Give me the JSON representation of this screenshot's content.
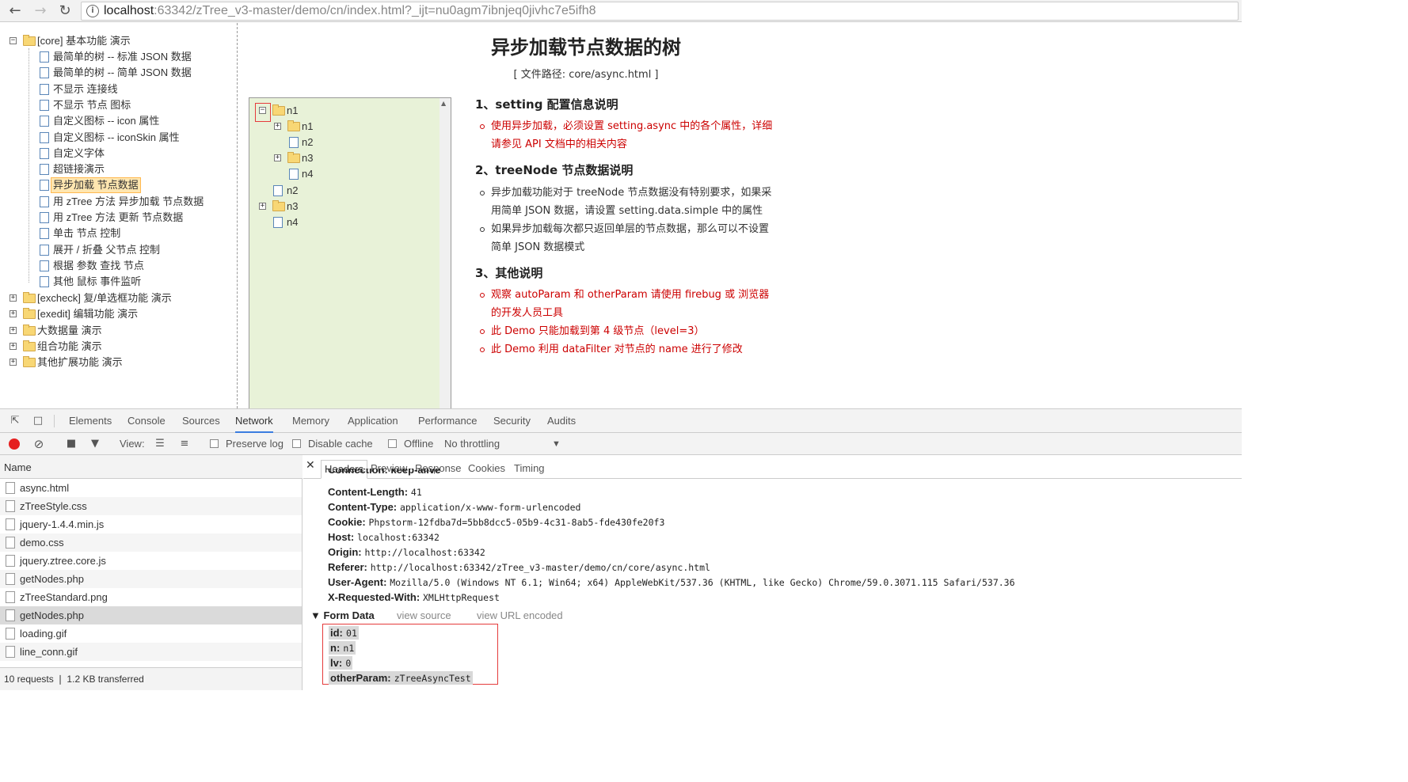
{
  "browser": {
    "url_host": "localhost",
    "url_rest": ":63342/zTree_v3-master/demo/cn/index.html?_ijt=nu0agm7ibnjeq0jivhc7e5ifh8",
    "info_icon": "i"
  },
  "nav_tree": {
    "core_label": "[core] 基本功能 演示",
    "core_items": [
      "最简单的树 -- 标准 JSON 数据",
      "最简单的树 -- 简单 JSON 数据",
      "不显示 连接线",
      "不显示 节点 图标",
      "自定义图标 -- icon 属性",
      "自定义图标 -- iconSkin 属性",
      "自定义字体",
      "超链接演示",
      "异步加载 节点数据",
      "用 zTree 方法 异步加载 节点数据",
      "用 zTree 方法 更新 节点数据",
      "单击 节点 控制",
      "展开 / 折叠 父节点 控制",
      "根据 参数 查找 节点",
      "其他 鼠标 事件监听"
    ],
    "other_groups": [
      "[excheck] 复/单选框功能 演示",
      "[exedit] 编辑功能 演示",
      "大数据量 演示",
      "组合功能 演示",
      "其他扩展功能 演示"
    ]
  },
  "demo_tree": {
    "n1": "n1",
    "n1_children": [
      "n1",
      "n2",
      "n3",
      "n4"
    ],
    "n2": "n2",
    "n3": "n3",
    "n4": "n4"
  },
  "content": {
    "title": "异步加载节点数据的树",
    "path": "[ 文件路径: core/async.html ]",
    "s1_head": "1、setting 配置信息说明",
    "s1_b1": "使用异步加载，必须设置 setting.async 中的各个属性，详细请参见 API 文档中的相关内容",
    "s2_head": "2、treeNode 节点数据说明",
    "s2_b1": "异步加载功能对于 treeNode 节点数据没有特别要求，如果采用简单 JSON 数据，请设置 setting.data.simple 中的属性",
    "s2_b2": "如果异步加载每次都只返回单层的节点数据，那么可以不设置简单 JSON 数据模式",
    "s3_head": "3、其他说明",
    "s3_b1": "观察 autoParam 和 otherParam 请使用 firebug 或 浏览器的开发人员工具",
    "s3_b2": "此 Demo 只能加载到第 4 级节点（level=3）",
    "s3_b3": "此 Demo 利用 dataFilter 对节点的 name 进行了修改"
  },
  "devtools": {
    "tabs": [
      "Elements",
      "Console",
      "Sources",
      "Network",
      "Memory",
      "Application",
      "Performance",
      "Security",
      "Audits"
    ],
    "toolbar": {
      "view": "View:",
      "preserve_log": "Preserve log",
      "disable_cache": "Disable cache",
      "offline": "Offline",
      "throttling": "No throttling"
    },
    "list_header": "Name",
    "requests": [
      "async.html",
      "zTreeStyle.css",
      "jquery-1.4.4.min.js",
      "demo.css",
      "jquery.ztree.core.js",
      "getNodes.php",
      "zTreeStandard.png",
      "getNodes.php",
      "loading.gif",
      "line_conn.gif"
    ],
    "footer": "10 requests ❘ 1.2 KB transferred",
    "detail_tabs": [
      "Headers",
      "Preview",
      "Response",
      "Cookies",
      "Timing"
    ],
    "partial_header": "Connection: keep-alive",
    "headers": [
      {
        "k": "Content-Length:",
        "v": "41"
      },
      {
        "k": "Content-Type:",
        "v": "application/x-www-form-urlencoded"
      },
      {
        "k": "Cookie:",
        "v": "Phpstorm-12fdba7d=5bb8dcc5-05b9-4c31-8ab5-fde430fe20f3"
      },
      {
        "k": "Host:",
        "v": "localhost:63342"
      },
      {
        "k": "Origin:",
        "v": "http://localhost:63342"
      },
      {
        "k": "Referer:",
        "v": "http://localhost:63342/zTree_v3-master/demo/cn/core/async.html"
      },
      {
        "k": "User-Agent:",
        "v": "Mozilla/5.0 (Windows NT 6.1; Win64; x64) AppleWebKit/537.36 (KHTML, like Gecko) Chrome/59.0.3071.115 Safari/537.36"
      },
      {
        "k": "X-Requested-With:",
        "v": "XMLHttpRequest"
      }
    ],
    "form_data_head": "Form Data",
    "view_source": "view source",
    "view_url_encoded": "view URL encoded",
    "form_data": [
      {
        "k": "id:",
        "v": "01"
      },
      {
        "k": "n:",
        "v": "n1"
      },
      {
        "k": "lv:",
        "v": "0"
      },
      {
        "k": "otherParam:",
        "v": "zTreeAsyncTest"
      }
    ]
  }
}
